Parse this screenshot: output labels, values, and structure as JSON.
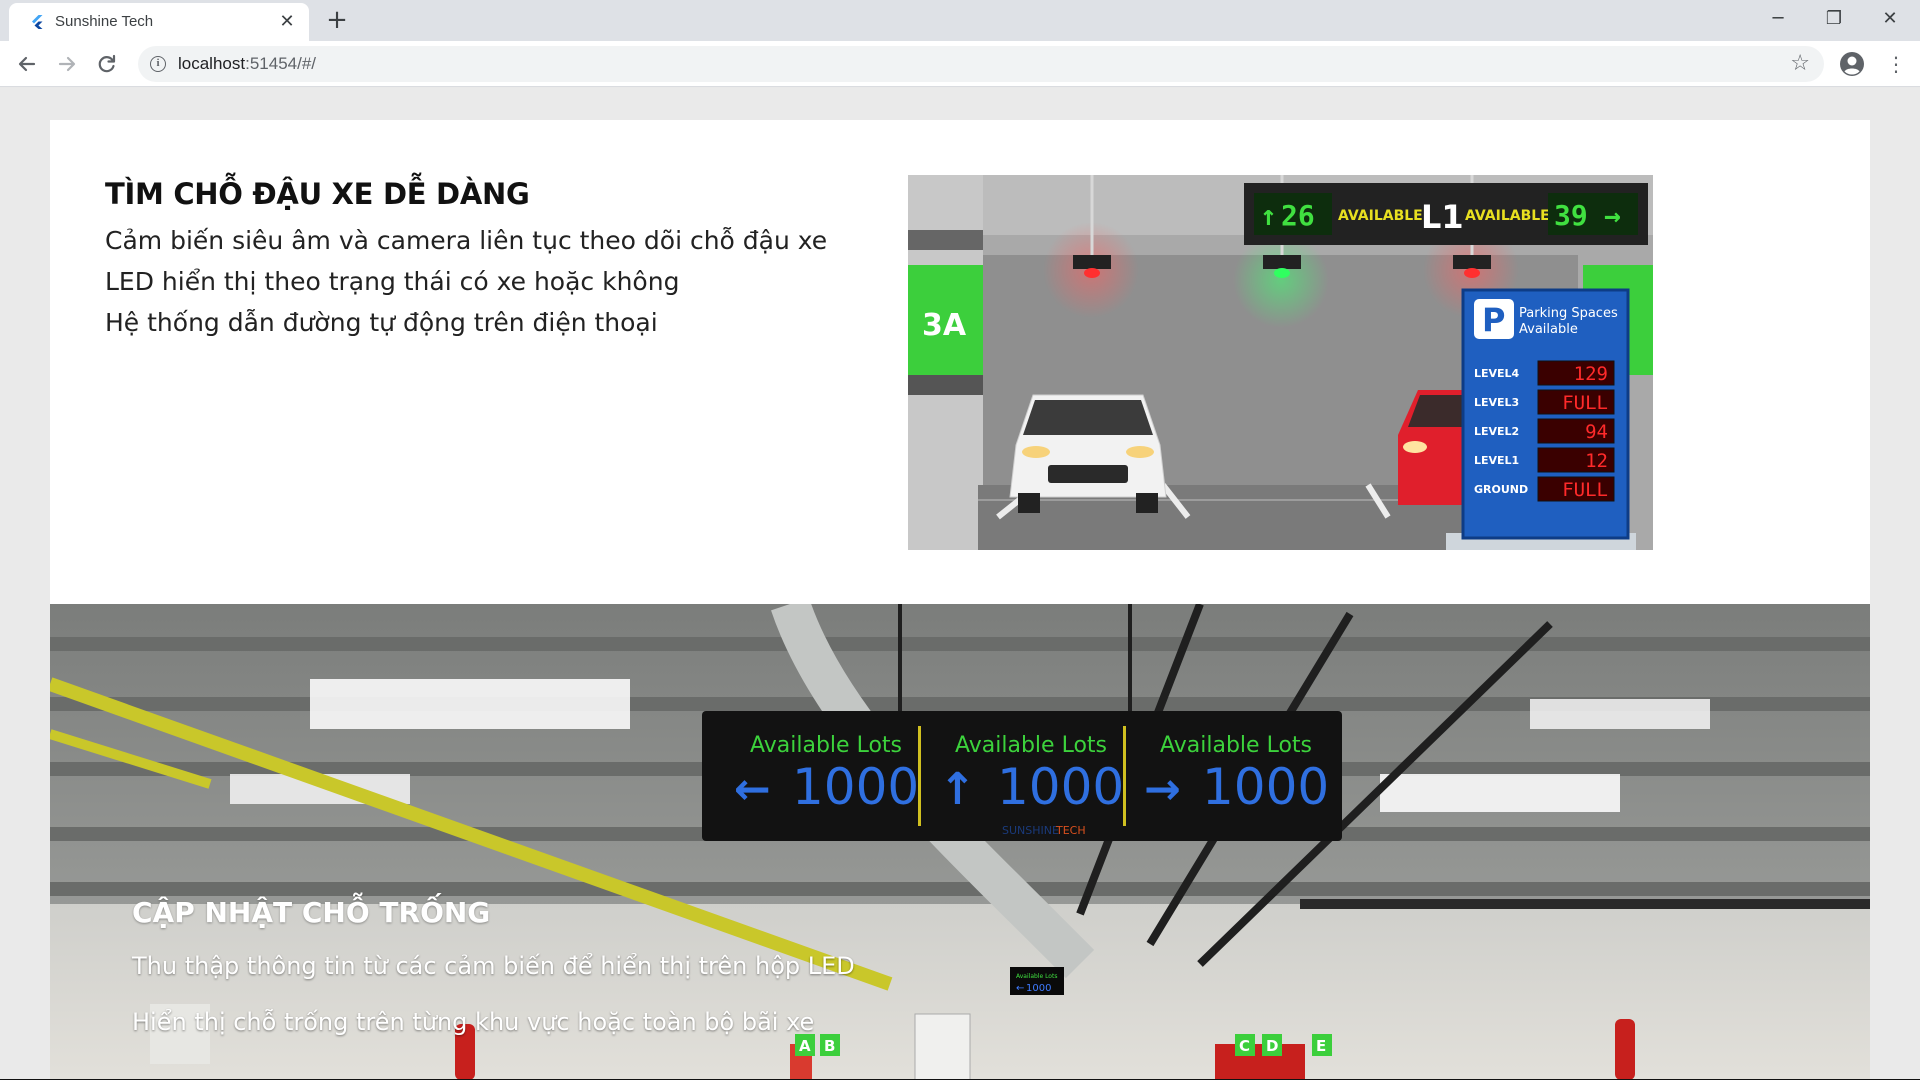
{
  "browser": {
    "tab_title": "Sunshine Tech",
    "tab_close": "✕",
    "new_tab": "+",
    "url_host": "localhost",
    "url_path": ":51454/#/",
    "controls": {
      "minimize": "─",
      "restore": "❐",
      "close": "✕"
    },
    "icons": [
      "flutter-favicon-icon",
      "back-icon",
      "forward-icon",
      "reload-icon",
      "info-icon",
      "star-icon",
      "profile-icon",
      "menu-icon"
    ]
  },
  "section1": {
    "title": "TÌM CHỖ ĐẬU XE DỄ DÀNG",
    "lines": [
      "Cảm biến siêu âm và camera liên tục theo dõi chỗ đậu xe",
      "LED hiển thị theo trạng thái có xe hoặc không",
      "Hệ thống dẫn đường tự động trên điện thoại"
    ],
    "illustration": {
      "zone_label": "3A",
      "sign_left_count": "26",
      "sign_available": "AVAILABLE",
      "sign_level": "L1",
      "sign_right_count": "39",
      "board_title_1": "Parking Spaces",
      "board_title_2": "Available",
      "board_rows": [
        {
          "level": "LEVEL4",
          "value": "129"
        },
        {
          "level": "LEVEL3",
          "value": "FULL"
        },
        {
          "level": "LEVEL2",
          "value": "94"
        },
        {
          "level": "LEVEL1",
          "value": "12"
        },
        {
          "level": "GROUND",
          "value": "FULL"
        }
      ]
    }
  },
  "section2": {
    "title": "CẬP NHẬT CHỖ TRỐNG",
    "lines": [
      "Thu thập thông tin từ các cảm biến để hiển thị trên hộp LED",
      "Hiển thị chỗ trống trên từng khu vực hoặc toàn bộ bãi xe"
    ],
    "led_panel": {
      "heading": "Available Lots",
      "count": "1000",
      "brand_a": "SUNSHINE",
      "brand_b": "TECH",
      "small_sign_label": "Available Lots",
      "small_sign_count": "1000"
    },
    "bay_letters": [
      "A",
      "B",
      "C",
      "D",
      "E"
    ]
  },
  "colors": {
    "led_green": "#3cd23c",
    "led_blue": "#2f6fe0",
    "led_red": "#ff2a2a",
    "sign_green": "#39c83c",
    "board_blue": "#1f5fc0"
  }
}
